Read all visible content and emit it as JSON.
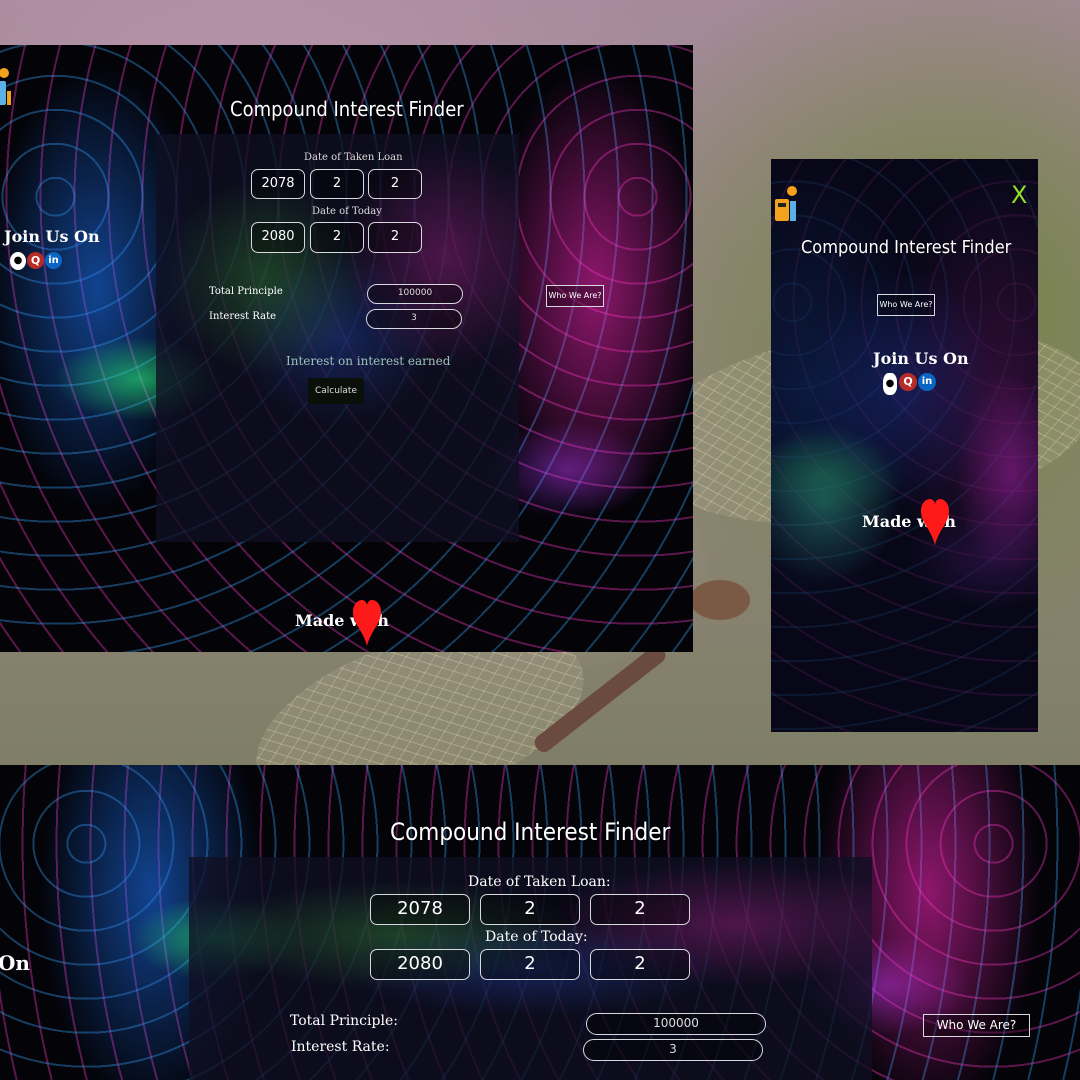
{
  "app": {
    "title": "Compound Interest Finder",
    "date_loan_label": "Date of Taken Loan",
    "date_loan_label_colon": "Date of Taken Loan:",
    "date_today_label": "Date of Today",
    "date_today_label_colon": "Date of Today:",
    "loan_year": "2078",
    "loan_month": "2",
    "loan_day": "2",
    "today_year": "2080",
    "today_month": "2",
    "today_day": "2",
    "total_principle_label": "Total Principle",
    "total_principle_label_colon": "Total Principle:",
    "interest_rate_label": "Interest Rate",
    "interest_rate_label_colon": "Interest Rate:",
    "principle_value": "100000",
    "rate_value": "3",
    "result_text": "Interest on interest earned",
    "calculate_label": "Calculate",
    "who_we_are_label": "Who We Are?",
    "join_us_label": "Join Us On",
    "join_us_partial": "On",
    "made_with_label": "Made with",
    "close_label": "X"
  },
  "icons": {
    "social": [
      "github-icon",
      "quora-icon",
      "linkedin-icon"
    ],
    "heart": "heart-icon",
    "logo": "calculator-logo-icon"
  },
  "colors": {
    "close": "#8ee02a",
    "heart": "#ff1a1a",
    "quora": "#b92b27",
    "linkedin": "#0a66c2"
  }
}
